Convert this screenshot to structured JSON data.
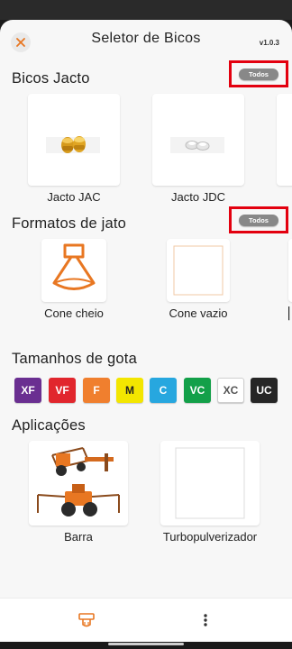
{
  "header": {
    "title": "Seletor de Bicos",
    "version": "v1.0.3",
    "close_icon": "close-icon"
  },
  "colors": {
    "accent": "#e87722",
    "highlight_box": "#e3000f",
    "background": "#f7f7f7"
  },
  "nozzles_section": {
    "title": "Bicos Jacto",
    "todos_label": "Todos",
    "items": [
      {
        "label": "Jacto JAC"
      },
      {
        "label": "Jacto JDC"
      }
    ]
  },
  "spray_section": {
    "title": "Formatos de jato",
    "todos_label": "Todos",
    "items": [
      {
        "label": "Cone cheio"
      },
      {
        "label": "Cone vazio"
      }
    ]
  },
  "drop_section": {
    "title": "Tamanhos de gota",
    "chips": [
      {
        "label": "XF",
        "color": "#6a2f91"
      },
      {
        "label": "VF",
        "color": "#e1262d"
      },
      {
        "label": "F",
        "color": "#f07f2e"
      },
      {
        "label": "M",
        "color": "#f3e600"
      },
      {
        "label": "C",
        "color": "#27a7df"
      },
      {
        "label": "VC",
        "color": "#13a049"
      },
      {
        "label": "XC",
        "color": "#ffffff"
      },
      {
        "label": "UC",
        "color": "#262626"
      }
    ]
  },
  "applications_section": {
    "title": "Aplicações",
    "items": [
      {
        "label": "Barra"
      },
      {
        "label": "Turbopulverizador"
      }
    ]
  },
  "bottom_nav": {
    "items": [
      {
        "icon": "nozzle-icon"
      },
      {
        "icon": "more-vertical-icon"
      }
    ]
  }
}
